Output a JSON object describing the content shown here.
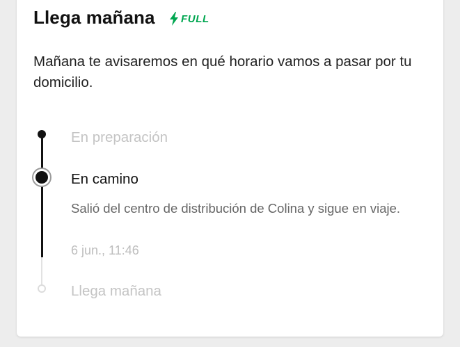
{
  "header": {
    "title": "Llega mañana",
    "badge_text": "FULL",
    "badge_icon": "lightning-bolt-icon",
    "badge_color": "#00a650"
  },
  "description": "Mañana te avisaremos en qué horario vamos a pasar por tu domicilio.",
  "timeline": {
    "steps": [
      {
        "label": "En preparación",
        "status": "completed"
      },
      {
        "label": "En camino",
        "status": "current",
        "detail": "Salió del centro de distribución de Colina y sigue en viaje.",
        "date": "6 jun., 11:46"
      },
      {
        "label": "Llega mañana",
        "status": "pending"
      }
    ],
    "colors": {
      "completed": "#111111",
      "pending": "#e2e2e2"
    }
  }
}
